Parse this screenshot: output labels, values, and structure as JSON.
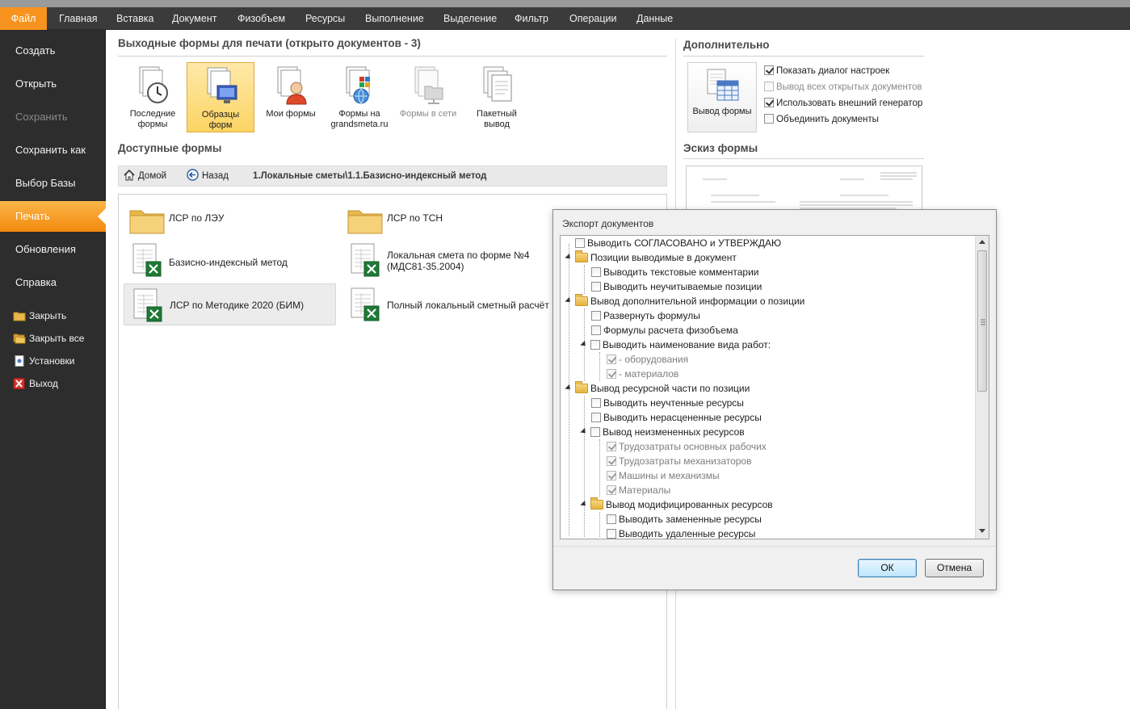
{
  "menu": [
    "Файл",
    "Главная",
    "Вставка",
    "Документ",
    "Физобъем",
    "Ресурсы",
    "Выполнение",
    "Выделение",
    "Фильтр",
    "Операции",
    "Данные"
  ],
  "nav": {
    "items": [
      "Создать",
      "Открыть",
      "Сохранить",
      "Сохранить как",
      "Выбор Базы",
      "Печать",
      "Обновления",
      "Справка"
    ],
    "small": [
      "Закрыть",
      "Закрыть все",
      "Установки",
      "Выход"
    ]
  },
  "print": {
    "heading": "Выходные формы для печати (открыто документов - 3)",
    "tiles": [
      "Последние\nформы",
      "Образцы\nформ",
      "Мои формы",
      "Формы на\ngrandsmeta.ru",
      "Формы в сети",
      "Пакетный\nвывод"
    ],
    "available_heading": "Доступные формы",
    "home": "Домой",
    "back": "Назад",
    "path": "1.Локальные сметы\\1.1.Базисно-индексный метод",
    "files": [
      "ЛСР по ЛЭУ",
      "ЛСР по ТСН",
      "Базисно-индексный метод",
      "Локальная смета по форме №4\n(МДС81-35.2004)",
      "ЛСР по Методике 2020 (БИМ)",
      "Полный локальный сметный расчёт"
    ]
  },
  "extra": {
    "heading": "Дополнительно",
    "output_button": "Вывод формы",
    "options": [
      {
        "label": "Показать диалог настроек",
        "checked": true,
        "enabled": true
      },
      {
        "label": "Вывод всех открытых документов",
        "checked": false,
        "enabled": false
      },
      {
        "label": "Использовать внешний генератор",
        "checked": true,
        "enabled": true
      },
      {
        "label": "Объединить документы",
        "checked": false,
        "enabled": true
      }
    ],
    "preview_heading": "Эскиз формы"
  },
  "dialog": {
    "title": "Экспорт документов",
    "tree": [
      "Выводить СОГЛАСОВАНО и УТВЕРЖДАЮ",
      "Позиции выводимые в документ",
      "Выводить текстовые комментарии",
      "Выводить неучитываемые позиции",
      "Вывод дополнительной информации о позиции",
      "Развернуть формулы",
      "Формулы расчета физобъема",
      "Выводить наименование вида работ:",
      "- оборудования",
      "- материалов",
      "Вывод ресурсной части по позиции",
      "Выводить неучтенные ресурсы",
      "Выводить нерасцененные ресурсы",
      "Вывод неизмененных ресурсов",
      "Трудозатраты основных рабочих",
      "Трудозатраты механизаторов",
      "Машины и механизмы",
      "Материалы",
      "Вывод модифицированных ресурсов",
      "Выводить замененные ресурсы",
      "Выводить удаленные ресурсы"
    ],
    "ok": "ОК",
    "cancel": "Отмена"
  }
}
